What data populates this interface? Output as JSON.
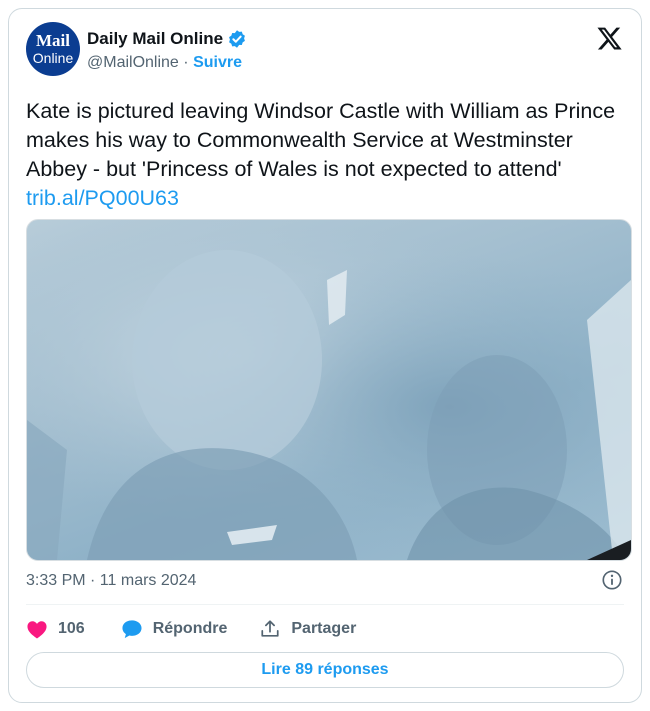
{
  "author": {
    "name": "Daily Mail Online",
    "handle": "@MailOnline",
    "separator": "·",
    "follow_label": "Suivre",
    "avatar_line1": "Mail",
    "avatar_line2": "Online",
    "verified": true
  },
  "tweet": {
    "text": "Kate is pictured leaving Windsor Castle with William as Prince makes his way to Commonwealth Service at Westminster Abbey - but 'Princess of Wales is not expected to attend'",
    "link": "trib.al/PQ00U63",
    "timestamp": "3:33 PM · 11 mars 2024"
  },
  "actions": {
    "like_count": "106",
    "reply_label": "Répondre",
    "share_label": "Partager"
  },
  "read_replies_label": "Lire 89 réponses",
  "colors": {
    "accent": "#1d9bf0",
    "like": "#f91880",
    "text": "#0f1419",
    "muted": "#536471",
    "avatar_bg": "#0b3d91"
  },
  "icons": [
    "x-logo-icon",
    "verified-badge-icon",
    "info-icon",
    "heart-icon",
    "reply-bubble-icon",
    "share-icon"
  ]
}
